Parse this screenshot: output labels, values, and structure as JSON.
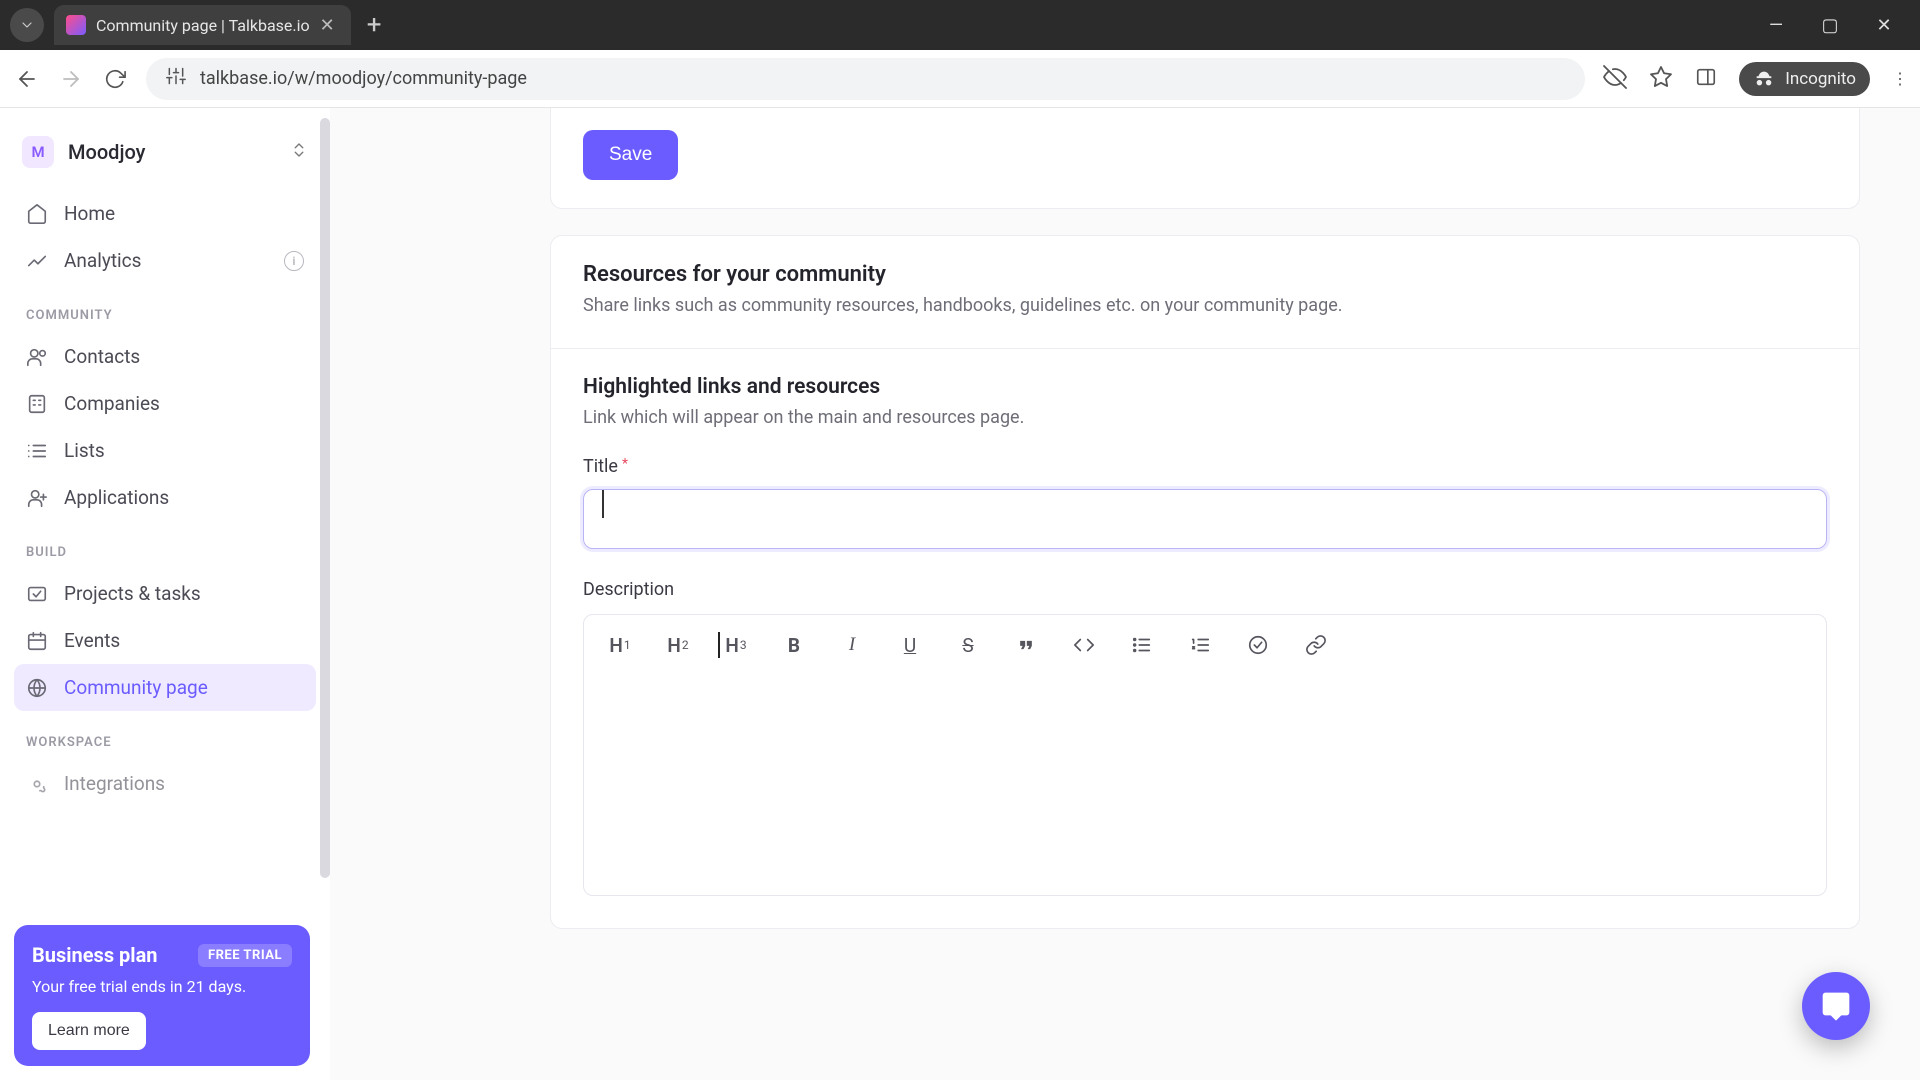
{
  "browser": {
    "tab_title": "Community page | Talkbase.io",
    "url": "talkbase.io/w/moodjoy/community-page",
    "incognito_label": "Incognito"
  },
  "workspace": {
    "initial": "M",
    "name": "Moodjoy"
  },
  "nav": {
    "home": "Home",
    "analytics": "Analytics",
    "section_community": "COMMUNITY",
    "contacts": "Contacts",
    "companies": "Companies",
    "lists": "Lists",
    "applications": "Applications",
    "section_build": "BUILD",
    "projects": "Projects & tasks",
    "events": "Events",
    "community_page": "Community page",
    "section_workspace": "WORKSPACE",
    "integrations": "Integrations"
  },
  "promo": {
    "title": "Business plan",
    "badge": "FREE TRIAL",
    "sub": "Your free trial ends in 21 days.",
    "cta": "Learn more"
  },
  "actions": {
    "save": "Save"
  },
  "resources": {
    "title": "Resources for your community",
    "sub": "Share links such as community resources, handbooks, guidelines etc. on your community page."
  },
  "highlighted": {
    "title": "Highlighted links and resources",
    "sub": "Link which will appear on the main and resources page.",
    "field_title_label": "Title",
    "field_title_value": "",
    "field_desc_label": "Description"
  },
  "toolbar": {
    "h1": "H",
    "h1s": "1",
    "h2": "H",
    "h2s": "2",
    "h3": "H",
    "h3s": "3"
  }
}
